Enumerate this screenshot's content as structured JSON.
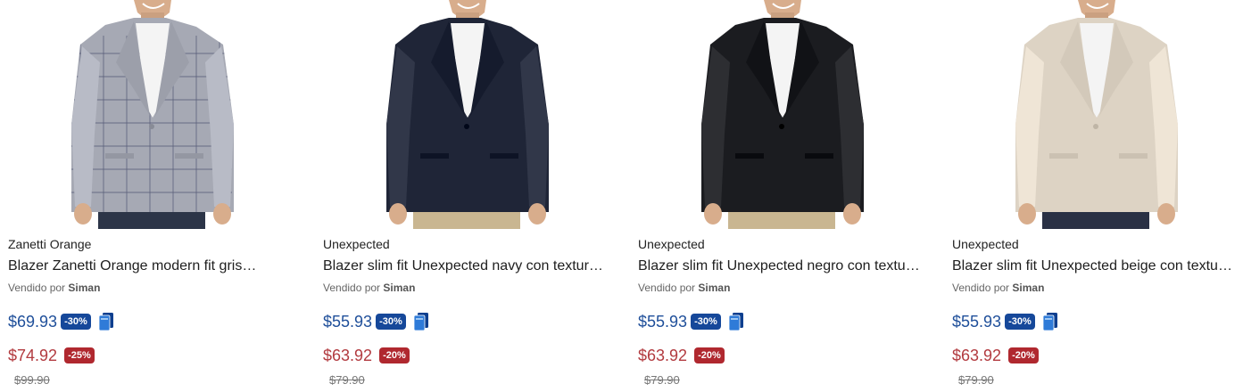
{
  "seller_prefix": "Vendido por",
  "products": [
    {
      "brand": "Zanetti Orange",
      "title": "Blazer Zanetti Orange modern fit gris…",
      "seller": "Siman",
      "card_price": "$69.93",
      "card_discount": "-30%",
      "sale_price": "$74.92",
      "sale_discount": "-25%",
      "original_price": "$99.90",
      "jacket_color": "#a6a9b4",
      "pants_color": "#2c3548",
      "plaid": true
    },
    {
      "brand": "Unexpected",
      "title": "Blazer slim fit Unexpected navy con textura…",
      "seller": "Siman",
      "card_price": "$55.93",
      "card_discount": "-30%",
      "sale_price": "$63.92",
      "sale_discount": "-20%",
      "original_price": "$79.90",
      "jacket_color": "#1f2537",
      "pants_color": "#c9b691",
      "plaid": false
    },
    {
      "brand": "Unexpected",
      "title": "Blazer slim fit Unexpected negro con textur…",
      "seller": "Siman",
      "card_price": "$55.93",
      "card_discount": "-30%",
      "sale_price": "$63.92",
      "sale_discount": "-20%",
      "original_price": "$79.90",
      "jacket_color": "#1b1c20",
      "pants_color": "#c9b691",
      "plaid": false
    },
    {
      "brand": "Unexpected",
      "title": "Blazer slim fit Unexpected beige con textur…",
      "seller": "Siman",
      "card_price": "$55.93",
      "card_discount": "-30%",
      "sale_price": "$63.92",
      "sale_discount": "-20%",
      "original_price": "$79.90",
      "jacket_color": "#ddd3c4",
      "pants_color": "#2a3145",
      "plaid": false
    }
  ],
  "colors": {
    "card_price": "#1f4f9a",
    "sale_price": "#b23a3f",
    "badge_blue": "#16489a",
    "badge_red": "#b0282f"
  },
  "icons": {
    "card_icon": "credit-card-icon"
  }
}
